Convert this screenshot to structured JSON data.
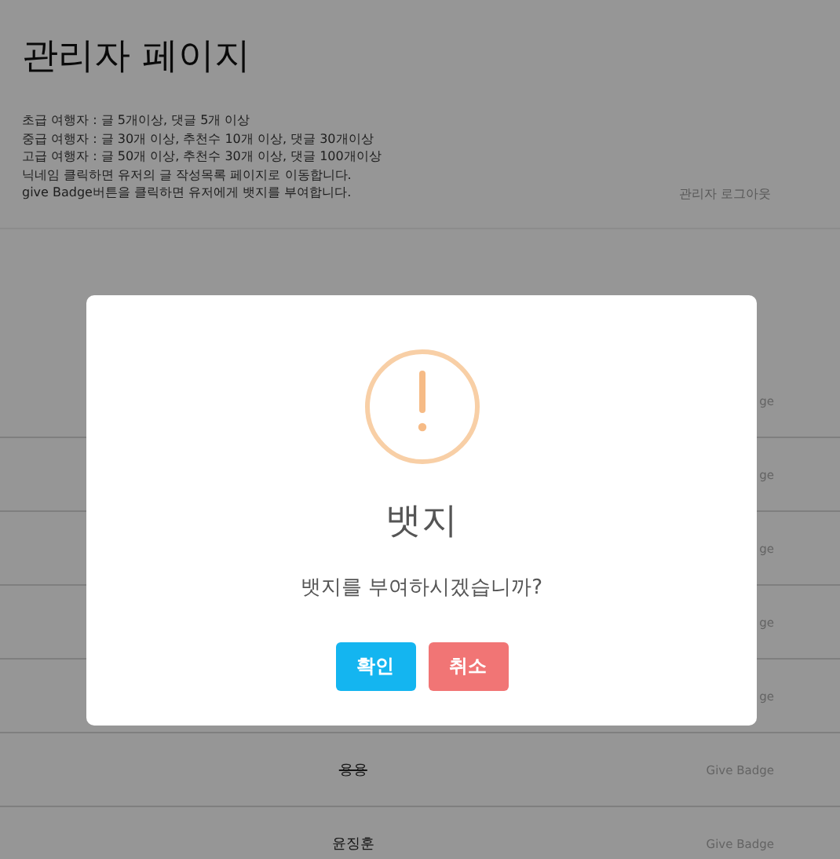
{
  "page": {
    "title": "관리자 페이지",
    "info_lines": [
      "초급 여행자 : 글 5개이상, 댓글 5개 이상",
      "중급 여행자 : 글 30개 이상, 추천수 10개 이상, 댓글 30개이상",
      "고급 여행자 : 글 50개 이상, 추천수 30개 이상, 댓글 100개이상",
      "닉네임 클릭하면 유저의 글 작성목록 페이지로 이동합니다.",
      "give Badge버튼을 클릭하면 유저에게 뱃지를 부여합니다."
    ],
    "logout": "관리자 로그아웃",
    "rows": [
      {
        "action": "ge"
      },
      {
        "action": "ge"
      },
      {
        "action": "ge"
      },
      {
        "action": "ge"
      },
      {
        "action": "ge"
      },
      {
        "name": "용용",
        "struck": true,
        "action": "Give Badge"
      },
      {
        "name": "윤징훈",
        "struck": false,
        "action": "Give Badge"
      }
    ]
  },
  "dialog": {
    "title": "뱃지",
    "message": "뱃지를 부여하시겠습니까?",
    "buttons": [
      {
        "label": "확인",
        "kind": "confirm"
      },
      {
        "label": "취소",
        "kind": "cancel"
      }
    ]
  }
}
